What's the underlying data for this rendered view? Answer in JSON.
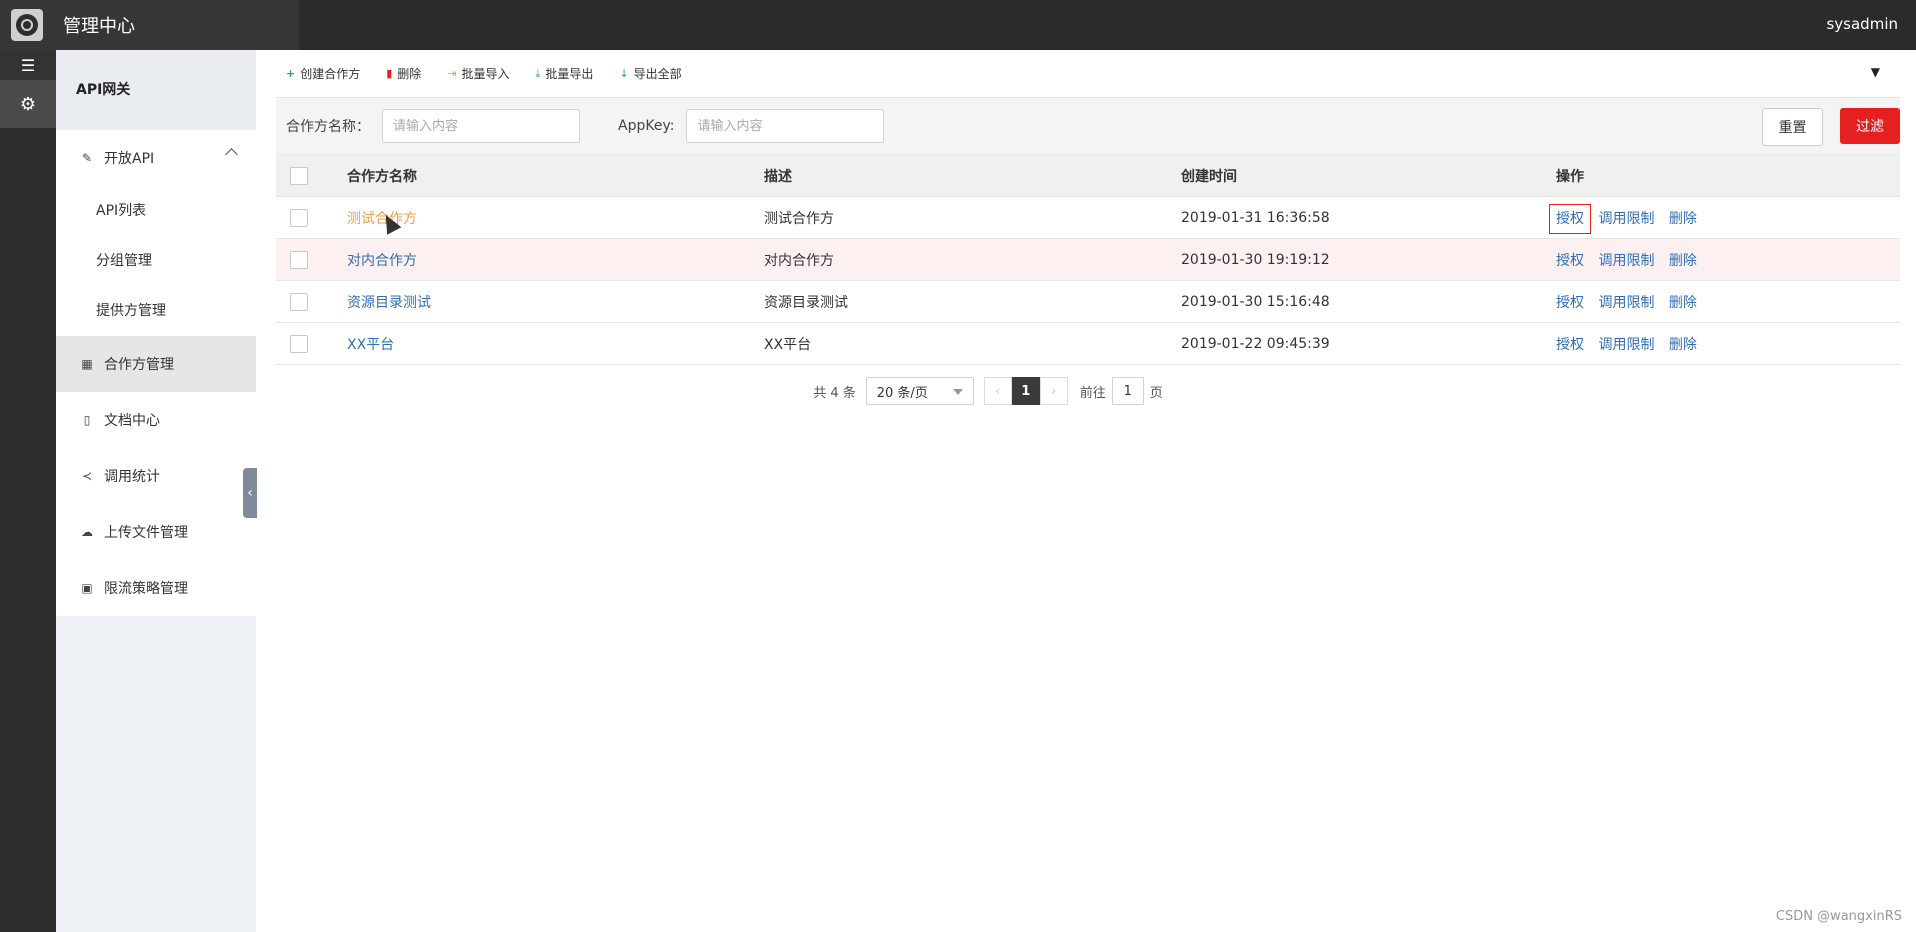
{
  "header": {
    "title": "管理中心",
    "user": "sysadmin"
  },
  "sidebar": {
    "section_title": "API网关",
    "items": [
      {
        "label": "开放API",
        "icon": "pencil-icon",
        "expanded": true,
        "children": [
          {
            "label": "API列表"
          },
          {
            "label": "分组管理"
          },
          {
            "label": "提供方管理"
          }
        ]
      },
      {
        "label": "合作方管理",
        "icon": "grid-icon",
        "active": true
      },
      {
        "label": "文档中心",
        "icon": "document-icon"
      },
      {
        "label": "调用统计",
        "icon": "share-icon"
      },
      {
        "label": "上传文件管理",
        "icon": "cloud-upload-icon"
      },
      {
        "label": "限流策略管理",
        "icon": "calendar-icon"
      }
    ]
  },
  "toolbar": {
    "create": "创建合作方",
    "delete": "删除",
    "import": "批量导入",
    "export": "批量导出",
    "export_all": "导出全部"
  },
  "search": {
    "name_label": "合作方名称：",
    "name_placeholder": "请输入内容",
    "appkey_label": "AppKey:",
    "appkey_placeholder": "请输入内容",
    "reset": "重置",
    "filter": "过滤"
  },
  "table": {
    "headers": [
      "合作方名称",
      "描述",
      "创建时间",
      "操作"
    ],
    "rows": [
      {
        "name": "测试合作方",
        "desc": "测试合作方",
        "created": "2019-01-31 16:36:58"
      },
      {
        "name": "对内合作方",
        "desc": "对内合作方",
        "created": "2019-01-30 19:19:12"
      },
      {
        "name": "资源目录测试",
        "desc": "资源目录测试",
        "created": "2019-01-30 15:16:48"
      },
      {
        "name": "XX平台",
        "desc": "XX平台",
        "created": "2019-01-22 09:45:39"
      }
    ],
    "actions": {
      "authorize": "授权",
      "rate_limit": "调用限制",
      "delete": "删除"
    }
  },
  "pagination": {
    "total": "共 4 条",
    "page_size": "20 条/页",
    "current_page": "1",
    "goto_label": "前往",
    "goto_value": "1",
    "goto_suffix": "页"
  },
  "watermark": "CSDN @wangxinRS"
}
